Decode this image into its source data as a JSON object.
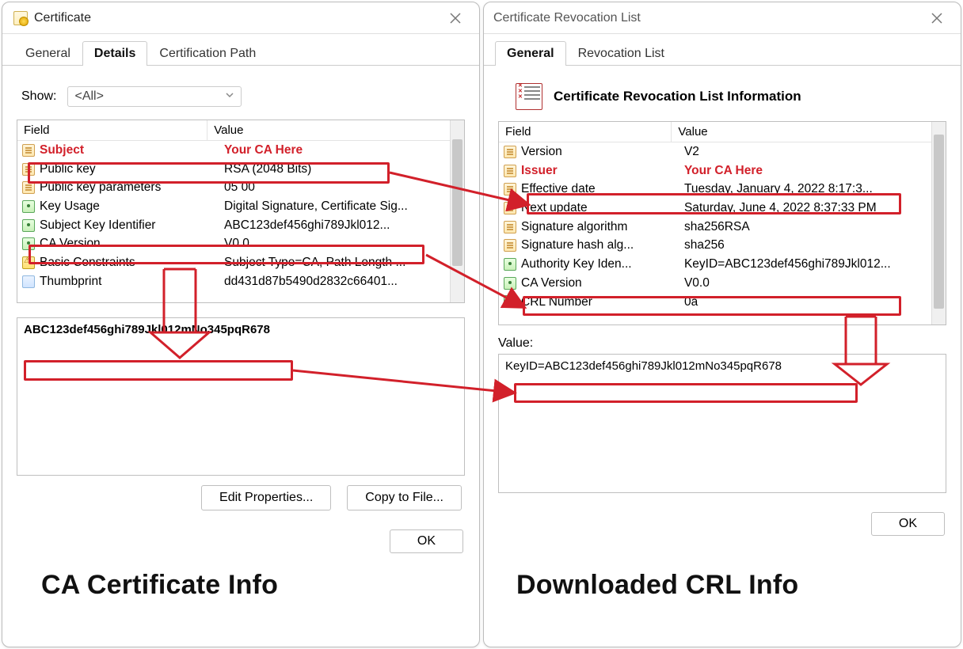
{
  "left": {
    "title": "Certificate",
    "tabs": [
      "General",
      "Details",
      "Certification Path"
    ],
    "active_tab": 1,
    "show_label": "Show:",
    "show_value": "<All>",
    "columns": {
      "field": "Field",
      "value": "Value"
    },
    "rows": [
      {
        "icon": "doc",
        "field": "Subject",
        "value": "Your CA Here",
        "highlight": true
      },
      {
        "icon": "doc",
        "field": "Public key",
        "value": "RSA (2048 Bits)"
      },
      {
        "icon": "doc",
        "field": "Public key parameters",
        "value": "05 00"
      },
      {
        "icon": "ext",
        "field": "Key Usage",
        "value": "Digital Signature, Certificate Sig..."
      },
      {
        "icon": "ext",
        "field": "Subject Key Identifier",
        "value": "ABC123def456ghi789Jkl012..."
      },
      {
        "icon": "ext",
        "field": "CA Version",
        "value": "V0.0"
      },
      {
        "icon": "bc",
        "field": "Basic Constraints",
        "value": "Subject Type=CA, Path Length ..."
      },
      {
        "icon": "th",
        "field": "Thumbprint",
        "value": "dd431d87b5490d2832c66401..."
      }
    ],
    "detail_value": "ABC123def456ghi789Jkl012mNo345pqR678",
    "btn_edit": "Edit Properties...",
    "btn_copy": "Copy to File...",
    "ok": "OK",
    "caption": "CA Certificate Info"
  },
  "right": {
    "title": "Certificate Revocation List",
    "tabs": [
      "General",
      "Revocation List"
    ],
    "active_tab": 0,
    "header_text": "Certificate Revocation List Information",
    "columns": {
      "field": "Field",
      "value": "Value"
    },
    "rows": [
      {
        "icon": "doc",
        "field": "Version",
        "value": "V2"
      },
      {
        "icon": "doc",
        "field": "Issuer",
        "value": "Your CA Here",
        "highlight": true
      },
      {
        "icon": "doc",
        "field": "Effective date",
        "value": "Tuesday, January 4, 2022 8:17:3..."
      },
      {
        "icon": "doc",
        "field": "Next update",
        "value": "Saturday, June 4, 2022 8:37:33 PM"
      },
      {
        "icon": "doc",
        "field": "Signature algorithm",
        "value": "sha256RSA"
      },
      {
        "icon": "doc",
        "field": "Signature hash alg...",
        "value": "sha256"
      },
      {
        "icon": "ext",
        "field": "Authority Key Iden...",
        "value": "KeyID=ABC123def456ghi789Jkl012..."
      },
      {
        "icon": "ext",
        "field": "CA Version",
        "value": "V0.0"
      },
      {
        "icon": "ext",
        "field": "CRL Number",
        "value": "0a"
      }
    ],
    "value_label": "Value:",
    "detail_value": "KeyID=ABC123def456ghi789Jkl012mNo345pqR678",
    "ok": "OK",
    "caption": "Downloaded CRL Info"
  },
  "annotation": {
    "color": "#d2202a"
  }
}
